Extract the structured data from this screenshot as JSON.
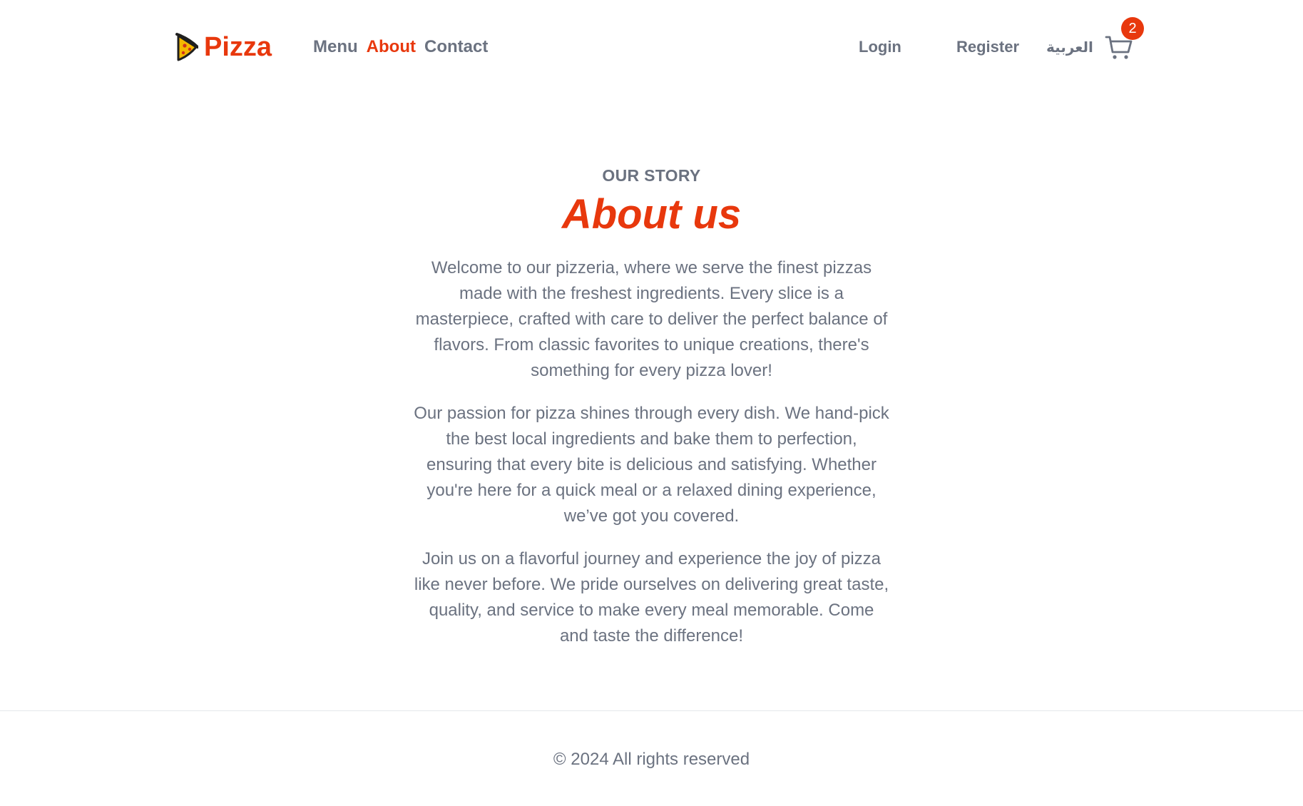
{
  "brand": {
    "name": "Pizza",
    "icon": "pizza-slice-icon",
    "color": "#e8380d"
  },
  "nav": {
    "items": [
      {
        "label": "Menu",
        "active": false
      },
      {
        "label": "About",
        "active": true
      },
      {
        "label": "Contact",
        "active": false
      }
    ]
  },
  "account": {
    "login_label": "Login",
    "register_label": "Register",
    "language_label": "العربية"
  },
  "cart": {
    "icon": "cart-icon",
    "count": "2"
  },
  "about": {
    "eyebrow": "OUR STORY",
    "title": "About us",
    "paragraphs": [
      "Welcome to our pizzeria, where we serve the finest pizzas made with the freshest ingredients. Every slice is a masterpiece, crafted with care to deliver the perfect balance of flavors. From classic favorites to unique creations, there's something for every pizza lover!",
      "Our passion for pizza shines through every dish. We hand-pick the best local ingredients and bake them to perfection, ensuring that every bite is delicious and satisfying. Whether you're here for a quick meal or a relaxed dining experience, we’ve got you covered.",
      "Join us on a flavorful journey and experience the joy of pizza like never before. We pride ourselves on delivering great taste, quality, and service to make every meal memorable. Come and taste the difference!"
    ]
  },
  "footer": {
    "copyright": "© 2024 All rights reserved"
  },
  "colors": {
    "accent": "#e8380d",
    "text_muted": "#6b7280"
  }
}
